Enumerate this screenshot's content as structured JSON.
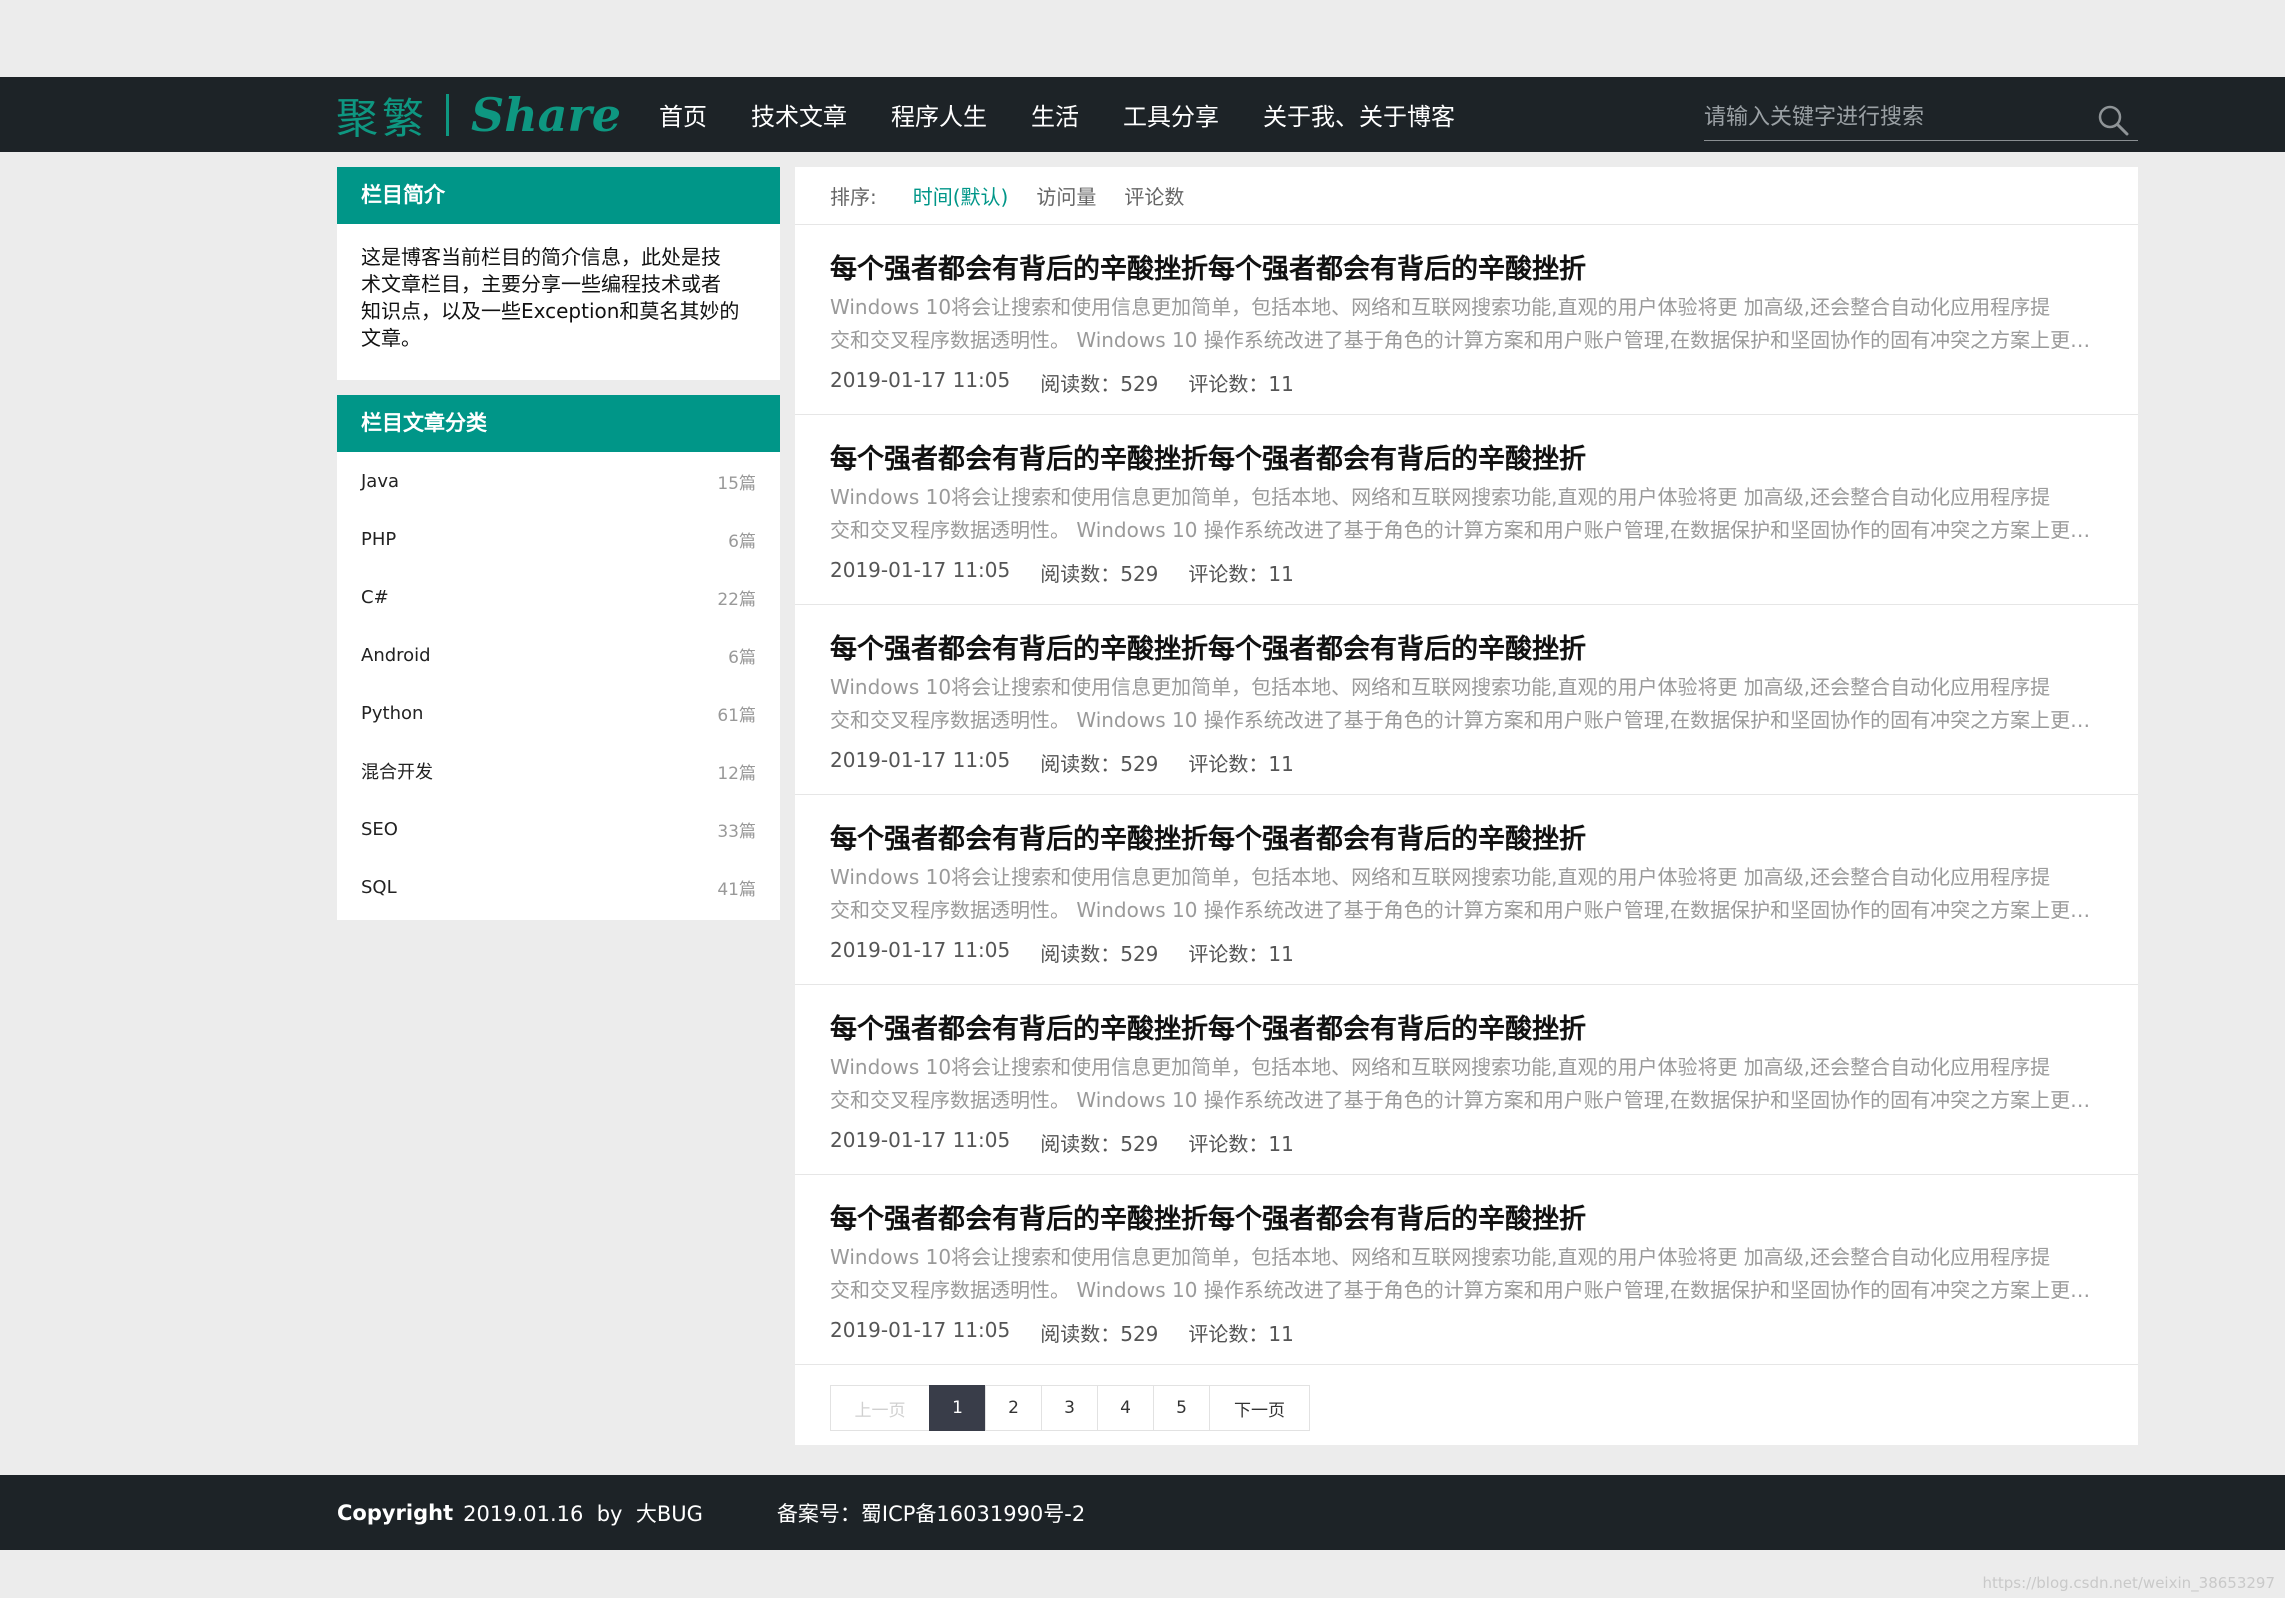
{
  "header": {
    "logo_cn": "聚繁",
    "logo_en": "Share",
    "menu": [
      "首页",
      "技术文章",
      "程序人生",
      "生活",
      "工具分享",
      "关于我、关于博客"
    ],
    "search_placeholder": "请输入关键字进行搜索",
    "search_icon": "search-icon"
  },
  "sidebar": {
    "intro_title": "栏目简介",
    "intro_lines": [
      "这是博客当前栏目的简介信息，此处是技",
      "术文章栏目，主要分享一些编程技术或者",
      "知识点，以及一些Exception和莫名其妙的",
      "文章。"
    ],
    "categories_title": "栏目文章分类",
    "categories": [
      {
        "name": "Java",
        "count": "15篇"
      },
      {
        "name": "PHP",
        "count": "6篇"
      },
      {
        "name": "C#",
        "count": "22篇"
      },
      {
        "name": "Android",
        "count": "6篇"
      },
      {
        "name": "Python",
        "count": "61篇"
      },
      {
        "name": "混合开发",
        "count": "12篇"
      },
      {
        "name": "SEO",
        "count": "33篇"
      },
      {
        "name": "SQL",
        "count": "41篇"
      }
    ]
  },
  "sort": {
    "label": "排序:",
    "options": [
      "时间(默认)",
      "访问量",
      "评论数"
    ],
    "active": 0
  },
  "articles": [
    {
      "title": "每个强者都会有背后的辛酸挫折每个强者都会有背后的辛酸挫折",
      "line1": "Windows 10将会让搜索和使用信息更加简单，包括本地、网络和互联网搜索功能,直观的用户体验将更 加高级,还会整合自动化应用程序提",
      "line2": "交和交叉程序数据透明性。 Windows 10 操作系统改进了基于角色的计算方案和用户账户管理,在数据保护和坚固协作的固有冲突之方案上更进一步",
      "date": "2019-01-17 11:05",
      "reads": "阅读数：529",
      "comments": "评论数：11"
    },
    {
      "title": "每个强者都会有背后的辛酸挫折每个强者都会有背后的辛酸挫折",
      "line1": "Windows 10将会让搜索和使用信息更加简单，包括本地、网络和互联网搜索功能,直观的用户体验将更 加高级,还会整合自动化应用程序提",
      "line2": "交和交叉程序数据透明性。 Windows 10 操作系统改进了基于角色的计算方案和用户账户管理,在数据保护和坚固协作的固有冲突之方案上更进一步",
      "date": "2019-01-17 11:05",
      "reads": "阅读数：529",
      "comments": "评论数：11"
    },
    {
      "title": "每个强者都会有背后的辛酸挫折每个强者都会有背后的辛酸挫折",
      "line1": "Windows 10将会让搜索和使用信息更加简单，包括本地、网络和互联网搜索功能,直观的用户体验将更 加高级,还会整合自动化应用程序提",
      "line2": "交和交叉程序数据透明性。 Windows 10 操作系统改进了基于角色的计算方案和用户账户管理,在数据保护和坚固协作的固有冲突之方案上更进一步",
      "date": "2019-01-17 11:05",
      "reads": "阅读数：529",
      "comments": "评论数：11"
    },
    {
      "title": "每个强者都会有背后的辛酸挫折每个强者都会有背后的辛酸挫折",
      "line1": "Windows 10将会让搜索和使用信息更加简单，包括本地、网络和互联网搜索功能,直观的用户体验将更 加高级,还会整合自动化应用程序提",
      "line2": "交和交叉程序数据透明性。 Windows 10 操作系统改进了基于角色的计算方案和用户账户管理,在数据保护和坚固协作的固有冲突之方案上更进一步",
      "date": "2019-01-17 11:05",
      "reads": "阅读数：529",
      "comments": "评论数：11"
    },
    {
      "title": "每个强者都会有背后的辛酸挫折每个强者都会有背后的辛酸挫折",
      "line1": "Windows 10将会让搜索和使用信息更加简单，包括本地、网络和互联网搜索功能,直观的用户体验将更 加高级,还会整合自动化应用程序提",
      "line2": "交和交叉程序数据透明性。 Windows 10 操作系统改进了基于角色的计算方案和用户账户管理,在数据保护和坚固协作的固有冲突之方案上更进一步",
      "date": "2019-01-17 11:05",
      "reads": "阅读数：529",
      "comments": "评论数：11"
    },
    {
      "title": "每个强者都会有背后的辛酸挫折每个强者都会有背后的辛酸挫折",
      "line1": "Windows 10将会让搜索和使用信息更加简单，包括本地、网络和互联网搜索功能,直观的用户体验将更 加高级,还会整合自动化应用程序提",
      "line2": "交和交叉程序数据透明性。 Windows 10 操作系统改进了基于角色的计算方案和用户账户管理,在数据保护和坚固协作的固有冲突之方案上更进一步",
      "date": "2019-01-17 11:05",
      "reads": "阅读数：529",
      "comments": "评论数：11"
    }
  ],
  "pagination": {
    "prev": "上一页",
    "pages": [
      "1",
      "2",
      "3",
      "4",
      "5"
    ],
    "current": 0,
    "next": "下一页"
  },
  "footer": {
    "copyright_label": "Copyright",
    "copyright_text": "2019.01.16  by  大BUG",
    "beian": "备案号：蜀ICP备16031990号-2",
    "watermark": "https://blog.csdn.net/weixin_38653297"
  },
  "colors": {
    "accent": "#009688",
    "logo": "#0e9781",
    "dark_bar": "#1d2327",
    "page_bg": "#ececec"
  }
}
